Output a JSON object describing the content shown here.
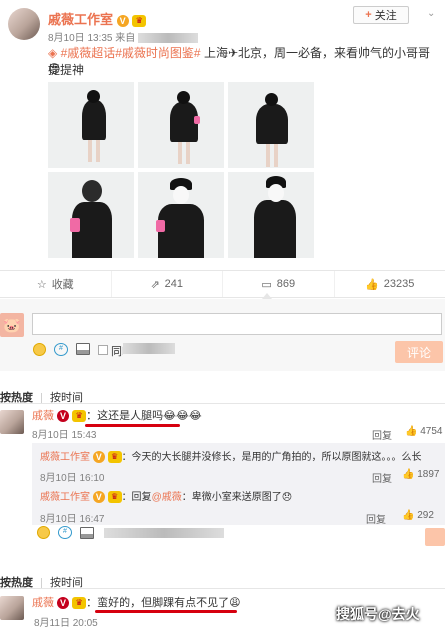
{
  "post": {
    "author": "戚薇工作室",
    "time": "8月10日 13:35",
    "source_prefix": "来自",
    "follow_label": "关注",
    "hashtags": "#戚薇超话#戚薇时尚图鉴#",
    "text": " 上海✈北京，周一必备，来看帅气的小哥哥提提神",
    "actions": {
      "favorite": "收藏",
      "repost": "241",
      "comment": "869",
      "like": "23235"
    }
  },
  "composer": {
    "sync_label": "同时转发",
    "submit_label": "评论"
  },
  "sort_tabs": {
    "hot": "按热度",
    "time": "按时间"
  },
  "comments": [
    {
      "author": "戚薇",
      "text": "：这还是人腿吗😂😂😂",
      "time": "8月10日 15:43",
      "reply_label": "回复",
      "likes": "4754",
      "replies": [
        {
          "author": "戚薇工作室",
          "text": "：今天的大长腿并没修长，是用的广角拍的，所以原图就这。。。么长",
          "time": "8月10日 16:10",
          "reply_label": "回复",
          "likes": "1897"
        },
        {
          "author": "戚薇工作室",
          "text_prefix": "：回复",
          "mention": "@戚薇",
          "text_suffix": "：卑微小室来送原图了😞",
          "time": "8月10日 16:47",
          "reply_label": "回复",
          "likes": "292"
        }
      ]
    },
    {
      "author": "戚薇",
      "text": "：蛮好的，但脚踝有点不见了😩",
      "time": "8月11日 20:05"
    }
  ],
  "watermark": "搜狐号@去火"
}
